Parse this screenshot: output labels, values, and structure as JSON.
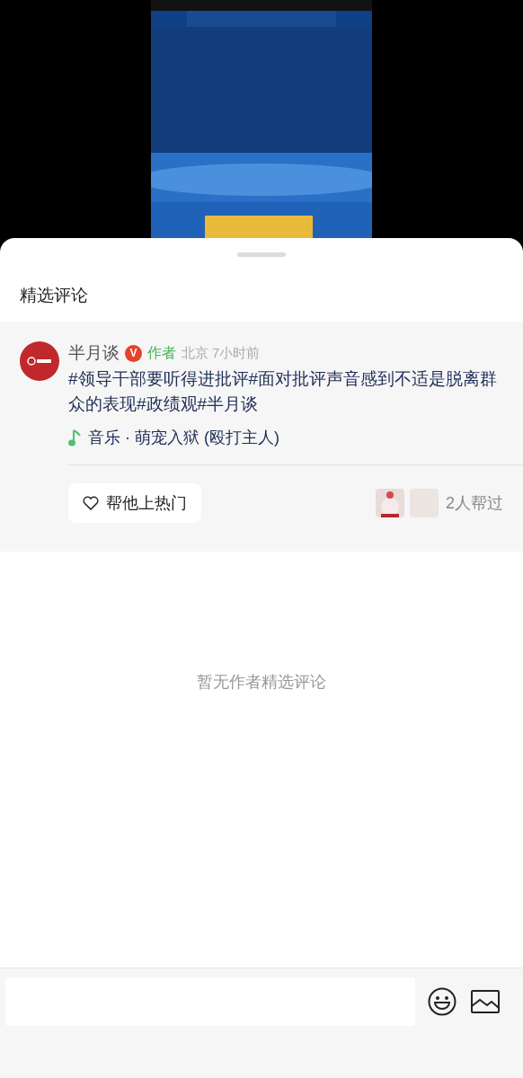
{
  "sheet": {
    "title": "精选评论"
  },
  "comment": {
    "author": "半月谈",
    "verified_badge": "V",
    "author_tag": "作者",
    "location": "北京",
    "time": "7小时前",
    "text": "#领导干部要听得进批评#面对批评声音感到不适是脱离群众的表现#政绩观#半月谈",
    "music": "音乐 · 萌宠入狱 (殴打主人)",
    "boost_button": "帮他上热门",
    "helpers": "2人帮过"
  },
  "empty_message": "暂无作者精选评论"
}
